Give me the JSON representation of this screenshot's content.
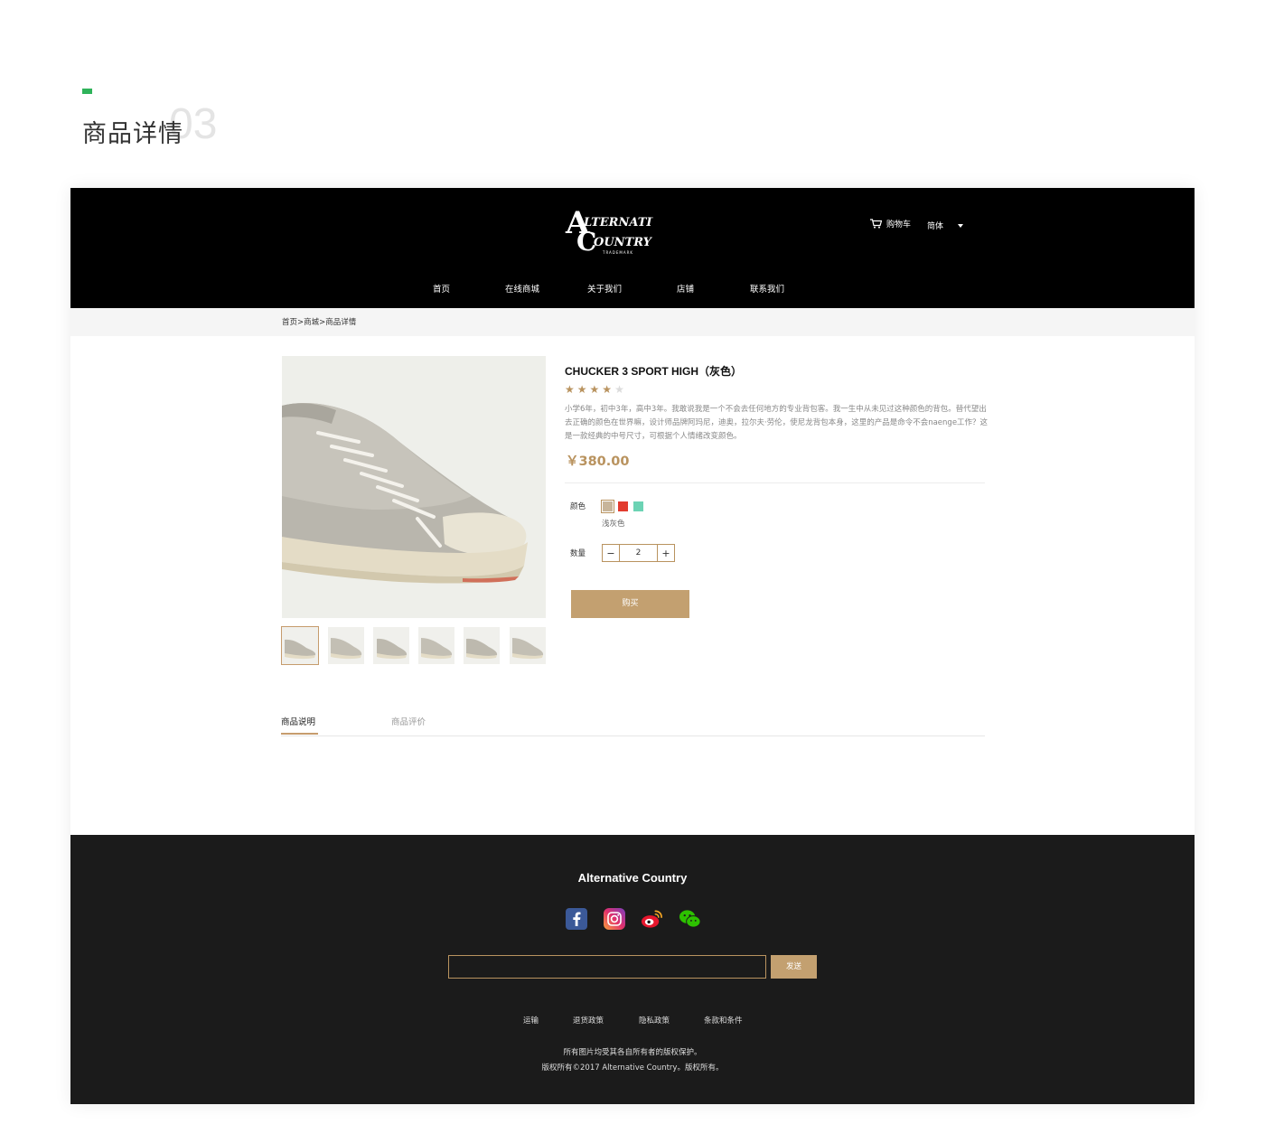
{
  "showcase": {
    "title": "商品详情",
    "number": "03"
  },
  "header": {
    "logo_text": "Alternative Country",
    "cart_label": "购物车",
    "language": "简体",
    "nav": [
      "首页",
      "在线商城",
      "关于我们",
      "店铺",
      "联系我们"
    ]
  },
  "breadcrumb": "首页>商城>商品详情",
  "product": {
    "title": "CHUCKER 3 SPORT HIGH（灰色）",
    "rating": 4,
    "rating_max": 5,
    "description": "小学6年，初中3年，高中3年。我敢说我是一个不会去任何地方的专业背包客。我一生中从未见过这种颜色的背包。替代望出去正确的颜色在世界嘛，设计师品牌阿玛尼，迪奥，拉尔夫·劳伦，使尼龙背包本身，这里的产品是命令不会naenge工作？这是一款经典的中号尺寸，可根据个人情绪改变颜色。",
    "price": "￥380.00",
    "color_label": "颜色",
    "colors": [
      "#c8b59a",
      "#e23b2e",
      "#6cd3b4"
    ],
    "selected_color_name": "浅灰色",
    "quantity_label": "数量",
    "quantity": "2",
    "minus": "−",
    "plus": "+",
    "buy_label": "购买"
  },
  "tabs": [
    "商品说明",
    "商品评价"
  ],
  "footer": {
    "brand": "Alternative Country",
    "social_icons": [
      "facebook-icon",
      "instagram-icon",
      "weibo-icon",
      "wechat-icon"
    ],
    "send_label": "发送",
    "links": [
      "运输",
      "退货政策",
      "隐私政策",
      "条款和条件"
    ],
    "copyright_1": "所有图片均受其各自所有者的版权保护。",
    "copyright_2": "版权所有©2017 Alternative Country。版权所有。"
  },
  "colors": {
    "accent": "#c3a070",
    "header_bg": "#000000",
    "footer_bg": "#1b1b1b",
    "green_mark": "#2fb35a"
  }
}
